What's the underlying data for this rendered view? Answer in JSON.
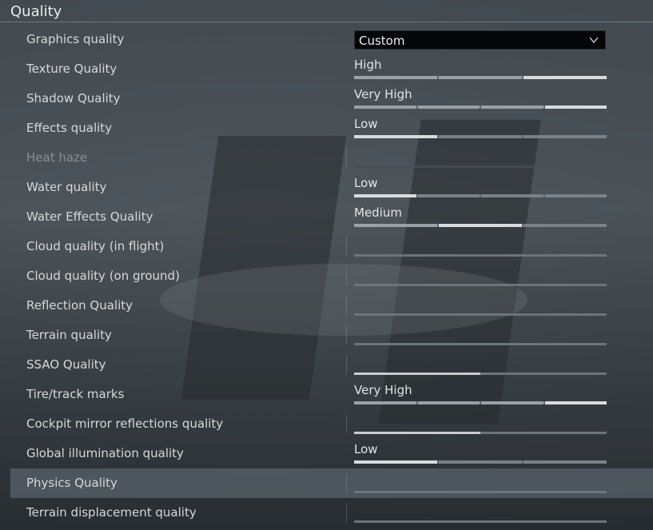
{
  "section": {
    "title": "Quality"
  },
  "graphics_quality": {
    "label": "Graphics quality",
    "value": "Custom"
  },
  "rows": [
    {
      "label": "Texture Quality",
      "value": "High",
      "levels": 3,
      "selected": 3
    },
    {
      "label": "Shadow Quality",
      "value": "Very High",
      "levels": 4,
      "selected": 4
    },
    {
      "label": "Effects quality",
      "value": "Low",
      "levels": 3,
      "selected": 1
    },
    {
      "label": "Heat haze",
      "value": "",
      "disabled": true,
      "fraction": 0
    },
    {
      "label": "Water quality",
      "value": "Low",
      "levels": 4,
      "selected": 1
    },
    {
      "label": "Water Effects Quality",
      "value": "Medium",
      "levels": 3,
      "selected": 2
    },
    {
      "label": "Cloud quality (in flight)",
      "value": "",
      "fraction": 0
    },
    {
      "label": "Cloud quality (on ground)",
      "value": "",
      "fraction": 0
    },
    {
      "label": "Reflection Quality",
      "value": "",
      "fraction": 0
    },
    {
      "label": "Terrain quality",
      "value": "",
      "fraction": 0
    },
    {
      "label": "SSAO Quality",
      "value": "",
      "fraction": 0.5
    },
    {
      "label": "Tire/track marks",
      "value": "Very High",
      "levels": 4,
      "selected": 4
    },
    {
      "label": "Cockpit mirror reflections quality",
      "value": "",
      "fraction": 0.5
    },
    {
      "label": "Global illumination quality",
      "value": "Low",
      "levels": 3,
      "selected": 1
    },
    {
      "label": "Physics Quality",
      "value": "",
      "fraction": 0,
      "highlighted": true
    },
    {
      "label": "Terrain displacement quality",
      "value": "",
      "fraction": 0
    }
  ]
}
